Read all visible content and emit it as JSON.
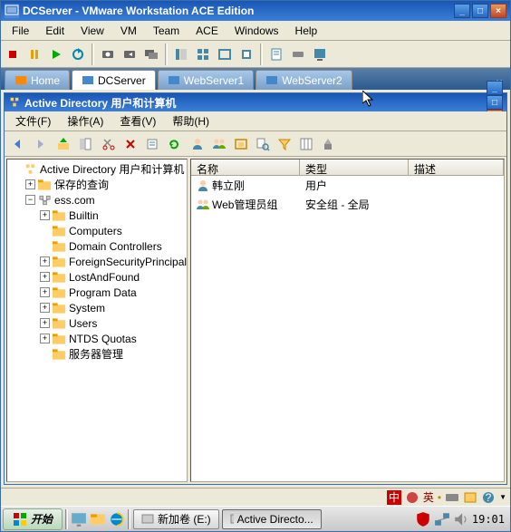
{
  "vmware": {
    "title": "DCServer - VMware Workstation ACE Edition",
    "menu": [
      "File",
      "Edit",
      "View",
      "VM",
      "Team",
      "ACE",
      "Windows",
      "Help"
    ],
    "tabs": [
      {
        "label": "Home",
        "active": false
      },
      {
        "label": "DCServer",
        "active": true
      },
      {
        "label": "WebServer1",
        "active": false
      },
      {
        "label": "WebServer2",
        "active": false
      }
    ]
  },
  "ad_window": {
    "title": "Active Directory 用户和计算机",
    "menu": [
      "文件(F)",
      "操作(A)",
      "查看(V)",
      "帮助(H)"
    ]
  },
  "tree": {
    "root": "Active Directory 用户和计算机",
    "saved_queries": "保存的查询",
    "domain": "ess.com",
    "children": [
      "Builtin",
      "Computers",
      "Domain Controllers",
      "ForeignSecurityPrincipals",
      "LostAndFound",
      "Program Data",
      "System",
      "Users",
      "NTDS Quotas",
      "服务器管理"
    ]
  },
  "list": {
    "columns": {
      "name": "名称",
      "type": "类型",
      "desc": "描述"
    },
    "col_widths": {
      "name": 120,
      "type": 120,
      "desc": 100
    },
    "rows": [
      {
        "name": "韩立刚",
        "type": "用户",
        "icon": "user"
      },
      {
        "name": "Web管理员组",
        "type": "安全组 - 全局",
        "icon": "group"
      }
    ]
  },
  "lang_bar": {
    "text": "英"
  },
  "taskbar": {
    "start": "开始",
    "tasks": [
      {
        "label": "新加卷 (E:)",
        "active": false
      },
      {
        "label": "Active Directo...",
        "active": true
      }
    ],
    "clock": "19:01"
  }
}
